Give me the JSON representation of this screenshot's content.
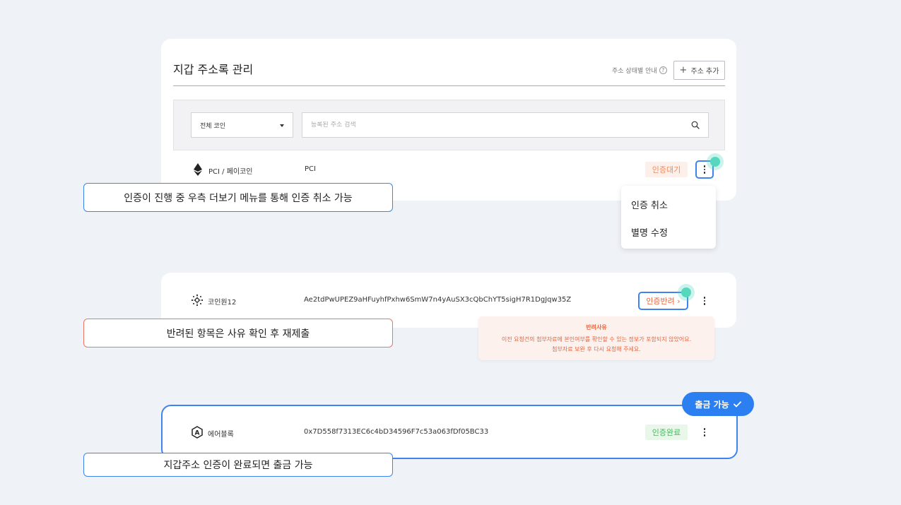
{
  "header": {
    "title": "지갑 주소록 관리",
    "help_text": "주소 상태별 안내",
    "add_button_label": "주소 추가"
  },
  "filter": {
    "coin_select_value": "전체 코인",
    "search_placeholder": "등록된 주소 검색"
  },
  "rows": [
    {
      "coin": "PCI / 페이코인",
      "address": "PCI",
      "status": "인증대기",
      "icon": "ethereum-icon"
    },
    {
      "coin": "코인원12",
      "address": "Ae2tdPwUPEZ9aHFuyhfPxhw6SmW7n4yAuSX3cQbChYT5sigH7R1DgJqw35Z",
      "status": "인증반려 ›",
      "icon": "cardano-icon"
    },
    {
      "coin": "에어블록",
      "address": "0x7D558f7313EC6c4bD34596F7c53a063fDf05BC33",
      "status": "인증완료",
      "icon": "airblock-icon"
    }
  ],
  "menu": {
    "items": [
      "인증 취소",
      "별명 수정"
    ]
  },
  "rejection_tooltip": {
    "title": "반려사유",
    "line1": "이전 요청건의 첨부자료에 본인여부를 확인할 수 있는 정보가 포함되지 않았어요.",
    "line2": "첨부자료 보완 후 다시 요청해 주세요."
  },
  "callouts": {
    "pending": "인증이 진행 중 우측 더보기 메뉴를 통해 인증 취소 가능",
    "rejected": "반려된 항목은 사유 확인 후 재제출",
    "done": "지갑주소 인증이 완료되면 출금 가능"
  },
  "withdraw_pill": "출금 가능",
  "colors": {
    "accent": "#3d84f0",
    "pending": "#ee8c62",
    "rejected": "#e8643c",
    "done": "#4fb663",
    "highlight_dot": "#55d8be"
  }
}
